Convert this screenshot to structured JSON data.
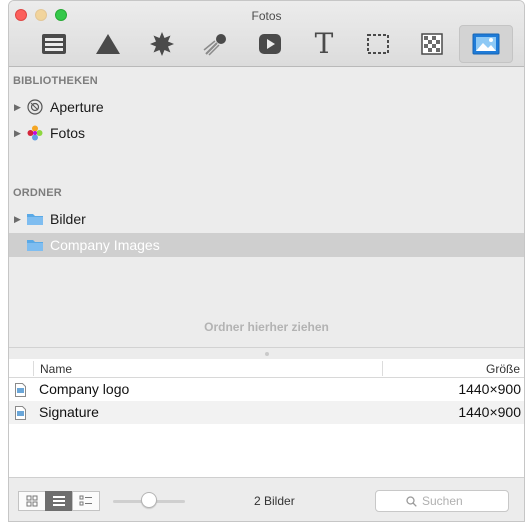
{
  "window": {
    "title": "Fotos"
  },
  "toolbar": {
    "tools": [
      {
        "icon": "browser-panel-icon"
      },
      {
        "icon": "shapes-triangle-icon"
      },
      {
        "icon": "burst-icon"
      },
      {
        "icon": "meteor-icon"
      },
      {
        "icon": "media-play-icon"
      },
      {
        "icon": "text-icon",
        "glyph": "T"
      },
      {
        "icon": "selection-marquee-icon"
      },
      {
        "icon": "pattern-checker-icon"
      },
      {
        "icon": "photo-icon"
      }
    ],
    "selected_index": 8
  },
  "sidebar": {
    "libraries_header": "BIBLIOTHEKEN",
    "libraries": [
      {
        "label": "Aperture",
        "icon": "aperture-icon"
      },
      {
        "label": "Fotos",
        "icon": "photos-flower-icon"
      }
    ],
    "folders_header": "ORDNER",
    "folders": [
      {
        "label": "Bilder",
        "icon": "folder-icon"
      },
      {
        "label": "Company Images",
        "icon": "folder-icon",
        "selected": true
      }
    ],
    "drop_hint": "Ordner hierher ziehen"
  },
  "table": {
    "columns": {
      "name": "Name",
      "size": "Größe"
    },
    "rows": [
      {
        "name": "Company logo",
        "size": "1440×900"
      },
      {
        "name": "Signature",
        "size": "1440×900"
      }
    ]
  },
  "bottombar": {
    "count": "2 Bilder",
    "search_placeholder": "Suchen",
    "active_view": "list"
  },
  "colors": {
    "selection": "#cfcfcf",
    "folder_blue": "#5aa9e6",
    "accent": "#1e7bd8"
  }
}
